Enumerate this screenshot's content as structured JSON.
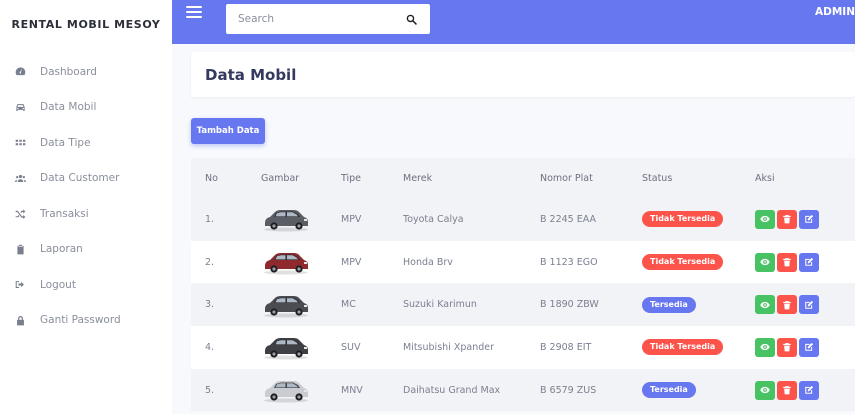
{
  "sidebar": {
    "brand": "RENTAL MOBIL MESOY",
    "items": [
      {
        "label": "Dashboard",
        "icon": "dashboard-icon"
      },
      {
        "label": "Data Mobil",
        "icon": "car-icon"
      },
      {
        "label": "Data Tipe",
        "icon": "grid-icon"
      },
      {
        "label": "Data Customer",
        "icon": "users-icon"
      },
      {
        "label": "Transaksi",
        "icon": "shuffle-icon"
      },
      {
        "label": "Laporan",
        "icon": "clipboard-icon"
      },
      {
        "label": "Logout",
        "icon": "logout-icon"
      },
      {
        "label": "Ganti Password",
        "icon": "lock-icon"
      }
    ]
  },
  "topbar": {
    "search_placeholder": "Search",
    "user": "ADMIN"
  },
  "page": {
    "title": "Data Mobil",
    "add_button": "Tambah Data"
  },
  "table": {
    "headers": [
      "No",
      "Gambar",
      "Tipe",
      "Merek",
      "Nomor Plat",
      "Status",
      "Aksi"
    ],
    "rows": [
      {
        "no": "1.",
        "tipe": "MPV",
        "merek": "Toyota Calya",
        "plat": "B 2245 EAA",
        "status": "Tidak Tersedia",
        "car_color": "#5a5d63"
      },
      {
        "no": "2.",
        "tipe": "MPV",
        "merek": "Honda Brv",
        "plat": "B 1123 EGO",
        "status": "Tidak Tersedia",
        "car_color": "#8e2a2e"
      },
      {
        "no": "3.",
        "tipe": "MC",
        "merek": "Suzuki Karimun",
        "plat": "B 1890 ZBW",
        "status": "Tersedia",
        "car_color": "#4a4c52"
      },
      {
        "no": "4.",
        "tipe": "SUV",
        "merek": "Mitsubishi Xpander",
        "plat": "B 2908 EIT",
        "status": "Tidak Tersedia",
        "car_color": "#3e4046"
      },
      {
        "no": "5.",
        "tipe": "MNV",
        "merek": "Daihatsu Grand Max",
        "plat": "B 6579 ZUS",
        "status": "Tersedia",
        "car_color": "#c9ccd1"
      }
    ]
  },
  "colors": {
    "primary": "#6777ef",
    "danger": "#fc544b",
    "success": "#47c363"
  }
}
